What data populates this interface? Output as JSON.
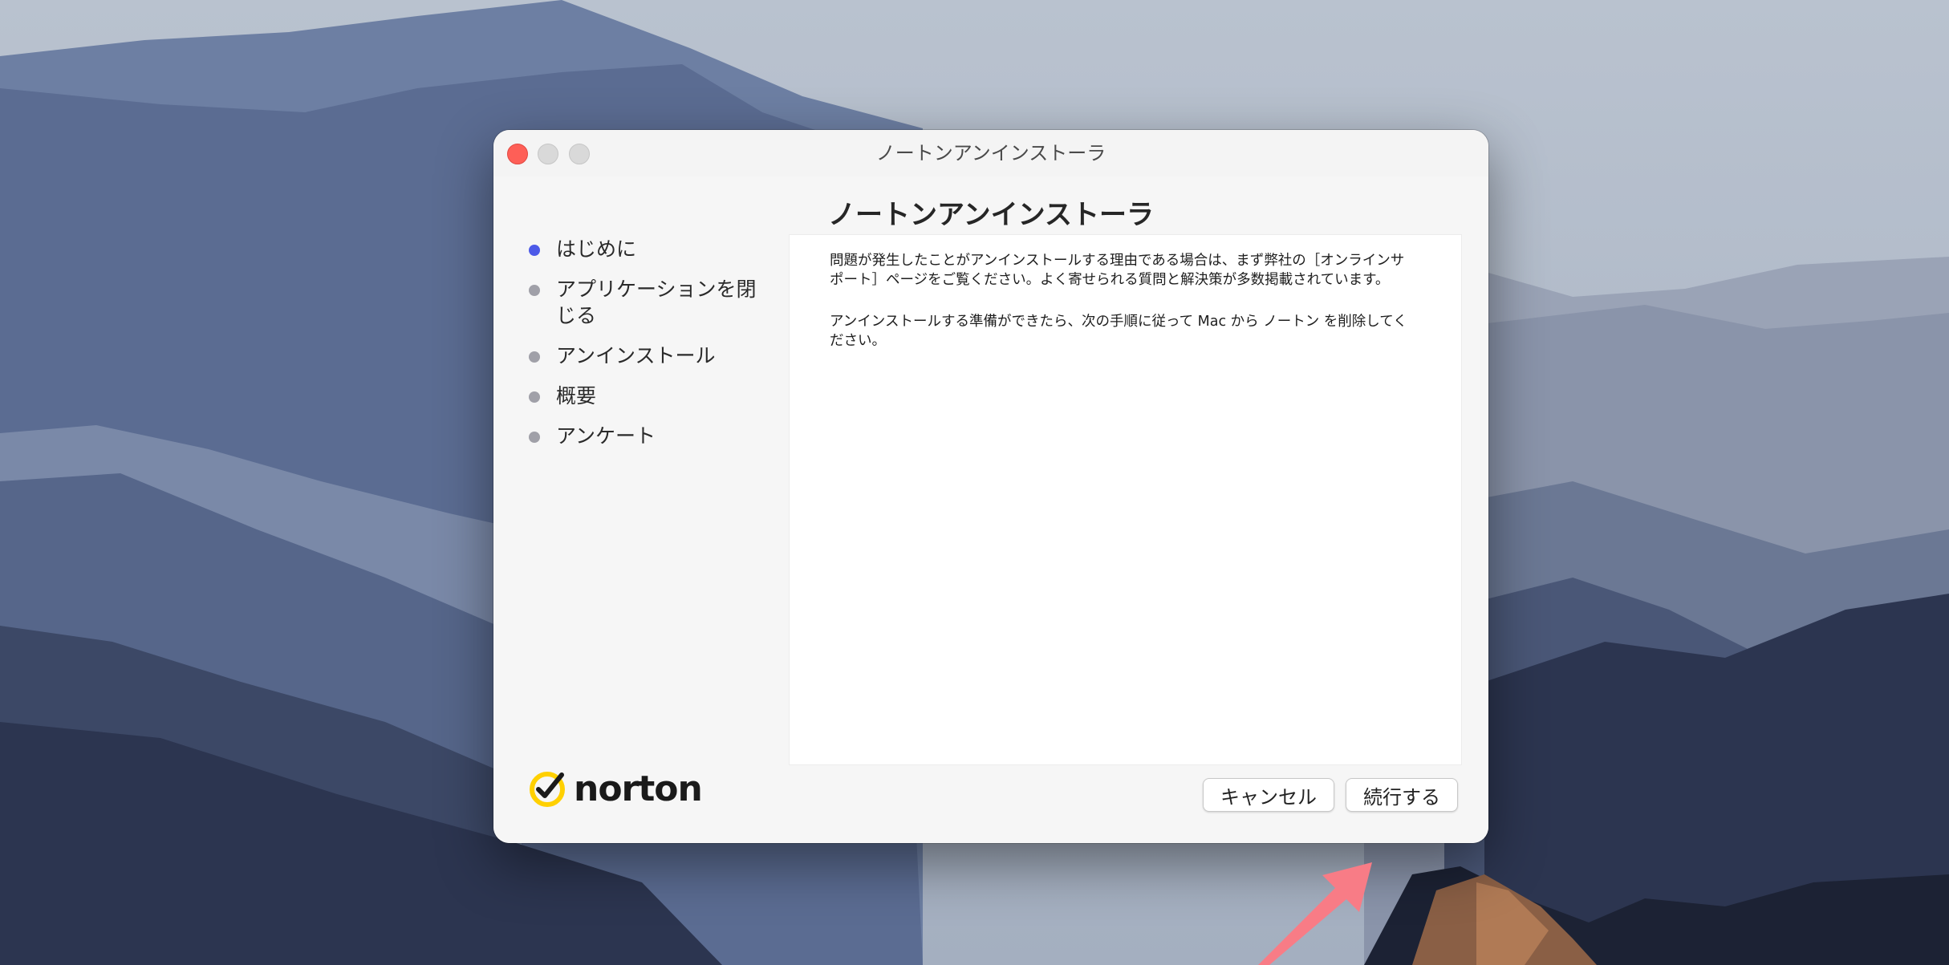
{
  "window": {
    "title": "ノートンアンインストーラ",
    "heading": "ノートンアンインストーラ"
  },
  "steps": [
    {
      "label": "はじめに",
      "active": true
    },
    {
      "label": "アプリケーションを閉じる",
      "active": false
    },
    {
      "label": "アンインストール",
      "active": false
    },
    {
      "label": "概要",
      "active": false
    },
    {
      "label": "アンケート",
      "active": false
    }
  ],
  "body": {
    "paragraph1": "問題が発生したことがアンインストールする理由である場合は、まず弊社の［オンラインサポート］ページをご覧ください。よく寄せられる質問と解決策が多数掲載されています。",
    "paragraph2": "アンインストールする準備ができたら、次の手順に従って Mac から ノートン を削除してください。"
  },
  "logo": {
    "text": "norton",
    "icon": "norton-check-icon",
    "accent": "#ffd000"
  },
  "buttons": {
    "cancel": "キャンセル",
    "continue": "続行する"
  },
  "colors": {
    "active_step": "#4d5ae8",
    "inactive_step": "#a0a0a8",
    "close": "#fe5f57",
    "arrow": "#f87c86"
  }
}
